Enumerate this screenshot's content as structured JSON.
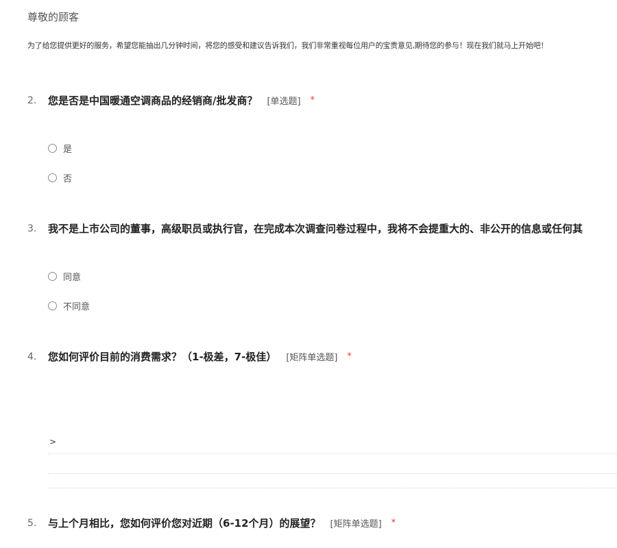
{
  "header": {
    "greeting": "尊敬的顾客",
    "intro": "为了给您提供更好的服务，希望您能抽出几分钟时间，将您的感受和建议告诉我们，我们非常重视每位用户的宝贵意见,期待您的参与！现在我们就马上开始吧！"
  },
  "questions": [
    {
      "number": "2.",
      "title": "您是否是中国暖通空调商品的经销商/批发商？",
      "type_label": "[单选题]",
      "required_mark": "*",
      "options": [
        "是",
        "否"
      ]
    },
    {
      "number": "3.",
      "title": "我不是上市公司的董事，高级职员或执行官，在完成本次调查问卷过程中，我将不会提重大的、非公开的信息或任何其",
      "options": [
        "同意",
        "不同意"
      ]
    },
    {
      "number": "4.",
      "title": "您如何评价目前的消费需求？（1-极差，7-极佳）",
      "type_label": "[矩阵单选题]",
      "required_mark": "*",
      "matrix_marker": ">"
    },
    {
      "number": "5.",
      "title": "与上个月相比，您如何评价您对近期（6-12个月）的展望？",
      "type_label": "[矩阵单选题]",
      "required_mark": "*"
    }
  ]
}
